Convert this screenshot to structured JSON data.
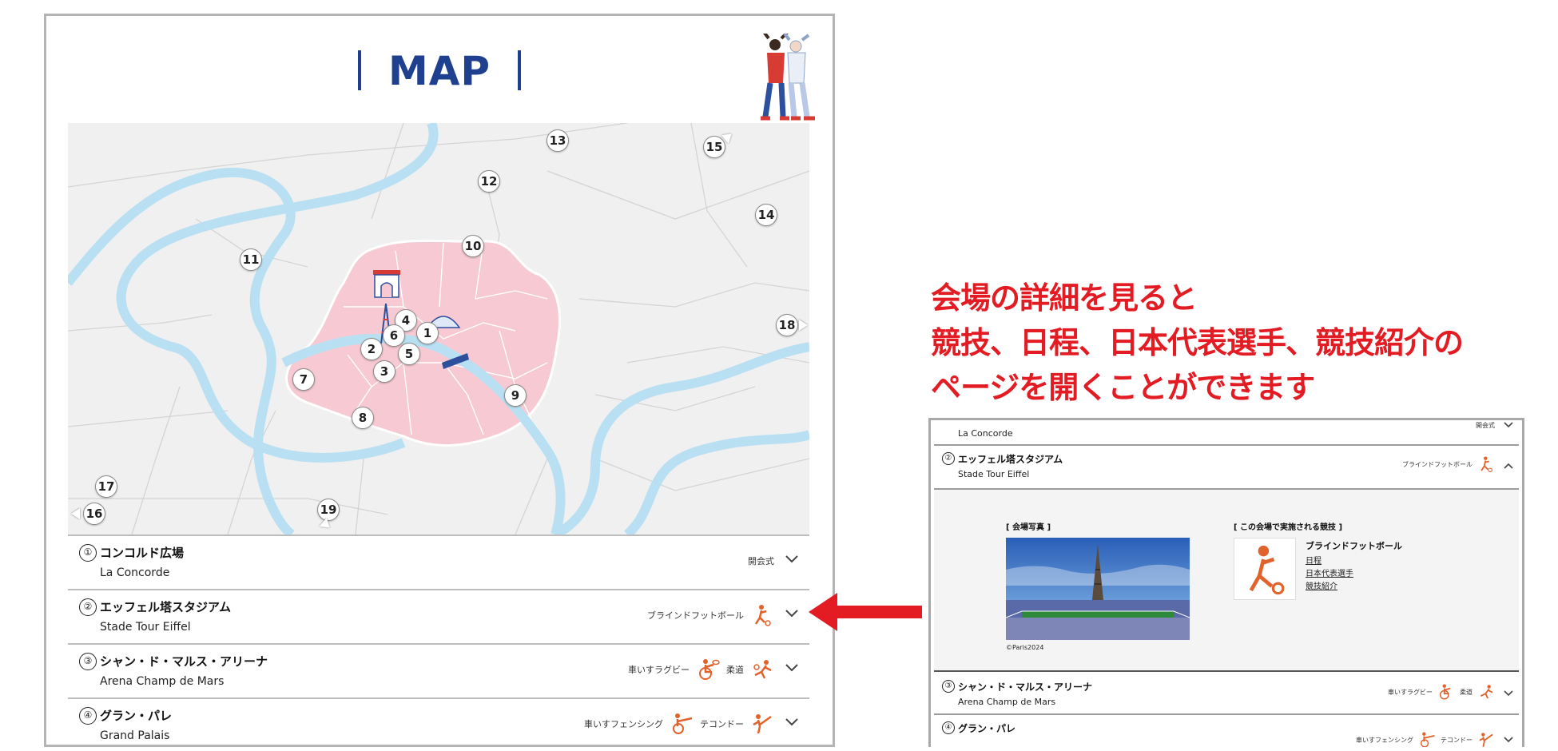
{
  "left_panel": {
    "title": "MAP",
    "map": {
      "pins": [
        "1",
        "2",
        "3",
        "4",
        "5",
        "6",
        "7",
        "8",
        "9",
        "10",
        "11",
        "12",
        "13",
        "14",
        "15",
        "16",
        "17",
        "18",
        "19"
      ]
    },
    "venues": [
      {
        "num": "①",
        "name_jp": "コンコルド広場",
        "name_en": "La Concorde",
        "sports": [
          "開会式"
        ]
      },
      {
        "num": "②",
        "name_jp": "エッフェル塔スタジアム",
        "name_en": "Stade Tour Eiffel",
        "sports": [
          "ブラインドフットボール"
        ]
      },
      {
        "num": "③",
        "name_jp": "シャン・ド・マルス・アリーナ",
        "name_en": "Arena Champ de Mars",
        "sports": [
          "車いすラグビー",
          "柔道"
        ]
      },
      {
        "num": "④",
        "name_jp": "グラン・パレ",
        "name_en": "Grand Palais",
        "sports": [
          "車いすフェンシング",
          "テコンドー"
        ]
      }
    ]
  },
  "callout": {
    "line1": "会場の詳細を見ると",
    "line2": "競技、日程、日本代表選手、競技紹介の",
    "line3": "ページを開くことができます"
  },
  "right_panel": {
    "row1": {
      "name_en": "La Concorde",
      "sport": "開会式"
    },
    "row2": {
      "num": "②",
      "name_jp": "エッフェル塔スタジアム",
      "name_en": "Stade Tour Eiffel",
      "sport": "ブラインドフットボール"
    },
    "detail": {
      "photo_heading": "[ 会場写真 ]",
      "sports_heading": "[ この会場で実施される競技 ]",
      "photo_credit": "©Paris2024",
      "sport_name": "ブラインドフットボール",
      "links": [
        "日程",
        "日本代表選手",
        "競技紹介"
      ]
    },
    "row3": {
      "num": "③",
      "name_jp": "シャン・ド・マルス・アリーナ",
      "name_en": "Arena Champ de Mars",
      "sports": [
        "車いすラグビー",
        "柔道"
      ]
    },
    "row4": {
      "num": "④",
      "name_jp": "グラン・パレ",
      "sports": [
        "車いすフェンシング",
        "テコンドー"
      ]
    }
  },
  "colors": {
    "title_blue": "#1f3f8f",
    "map_pink": "#f7c9d2",
    "river_blue": "#b9e0f2",
    "accent_red": "#e31b23",
    "sport_orange": "#e2622b"
  },
  "icons": {
    "mascots": "mascot-pair-illustration",
    "chevron_down": "chevron-down-icon",
    "chevron_up": "chevron-up-icon",
    "blind_football": "blind-football-icon",
    "wheelchair_rugby": "wheelchair-rugby-icon",
    "judo": "judo-icon",
    "wheelchair_fencing": "wheelchair-fencing-icon",
    "taekwondo": "taekwondo-icon"
  }
}
